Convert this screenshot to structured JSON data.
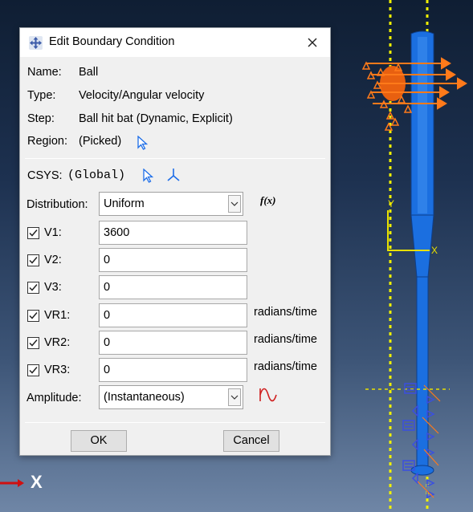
{
  "dialog": {
    "title": "Edit Boundary Condition",
    "name_label": "Name:",
    "name_value": "Ball",
    "type_label": "Type:",
    "type_value": "Velocity/Angular velocity",
    "step_label": "Step:",
    "step_value": "Ball hit bat (Dynamic, Explicit)",
    "region_label": "Region:",
    "region_value": "(Picked)",
    "csys_label": "CSYS:",
    "csys_value": "(Global)",
    "distribution_label": "Distribution:",
    "distribution_value": "Uniform",
    "fx_label": "f(x)",
    "fields": [
      {
        "label": "V1:",
        "value": "3600",
        "checked": true,
        "unit": ""
      },
      {
        "label": "V2:",
        "value": "0",
        "checked": true,
        "unit": ""
      },
      {
        "label": "V3:",
        "value": "0",
        "checked": true,
        "unit": ""
      },
      {
        "label": "VR1:",
        "value": "0",
        "checked": true,
        "unit": "radians/time"
      },
      {
        "label": "VR2:",
        "value": "0",
        "checked": true,
        "unit": "radians/time"
      },
      {
        "label": "VR3:",
        "value": "0",
        "checked": true,
        "unit": "radians/time"
      }
    ],
    "amplitude_label": "Amplitude:",
    "amplitude_value": "(Instantaneous)",
    "ok_label": "OK",
    "cancel_label": "Cancel"
  },
  "viewport": {
    "axis_label": "X",
    "csys_y_label": "Y",
    "csys_x_label": "X",
    "colors": {
      "bat": "#1b6fe0",
      "load_arrows": "#ff7a1a",
      "guide_lines": "#f0f000"
    }
  }
}
